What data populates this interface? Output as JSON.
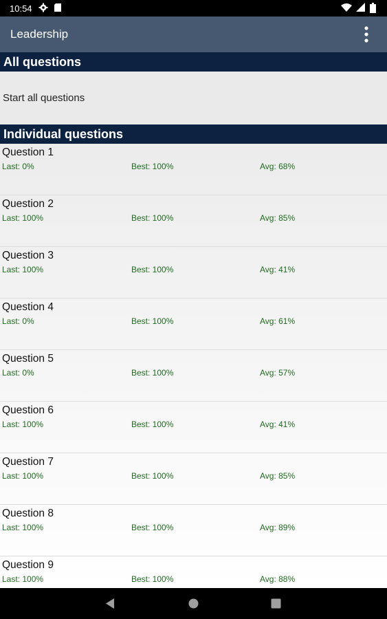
{
  "status_bar": {
    "time": "10:54"
  },
  "app_bar": {
    "title": "Leadership"
  },
  "sections": {
    "all_questions_header": "All questions",
    "start_all_label": "Start all questions",
    "individual_header": "Individual questions"
  },
  "questions": [
    {
      "title": "Question 1",
      "last": "Last: 0%",
      "best": "Best: 100%",
      "avg": "Avg: 68%"
    },
    {
      "title": "Question 2",
      "last": "Last: 100%",
      "best": "Best: 100%",
      "avg": "Avg: 85%"
    },
    {
      "title": "Question 3",
      "last": "Last: 100%",
      "best": "Best: 100%",
      "avg": "Avg: 41%"
    },
    {
      "title": "Question 4",
      "last": "Last: 0%",
      "best": "Best: 100%",
      "avg": "Avg: 61%"
    },
    {
      "title": "Question 5",
      "last": "Last: 0%",
      "best": "Best: 100%",
      "avg": "Avg: 57%"
    },
    {
      "title": "Question 6",
      "last": "Last: 100%",
      "best": "Best: 100%",
      "avg": "Avg: 41%"
    },
    {
      "title": "Question 7",
      "last": "Last: 100%",
      "best": "Best: 100%",
      "avg": "Avg: 85%"
    },
    {
      "title": "Question 8",
      "last": "Last: 100%",
      "best": "Best: 100%",
      "avg": "Avg: 89%"
    },
    {
      "title": "Question 9",
      "last": "Last: 100%",
      "best": "Best: 100%",
      "avg": "Avg: 88%"
    }
  ],
  "colors": {
    "app_bar": "#475970",
    "section_header": "#0d2240",
    "stat_text": "#1e6b1e"
  },
  "icons": {
    "status_left": [
      "gear-icon",
      "sd-card-icon"
    ],
    "status_right": [
      "wifi-icon",
      "signal-icon",
      "battery-icon"
    ],
    "app_bar": [
      "overflow-menu-icon"
    ],
    "nav": [
      "back-icon",
      "home-icon",
      "recents-icon"
    ]
  }
}
